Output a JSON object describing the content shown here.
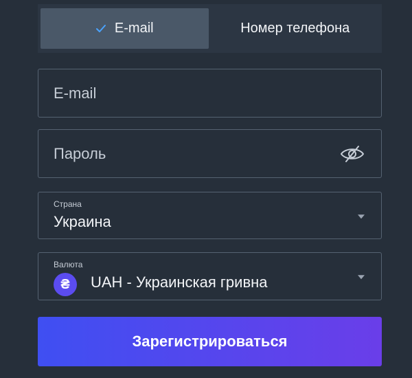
{
  "tabs": {
    "email_label": "E-mail",
    "phone_label": "Номер телефона",
    "active": "email"
  },
  "form": {
    "email_placeholder": "E-mail",
    "password_placeholder": "Пароль",
    "country_label": "Страна",
    "country_value": "Украина",
    "currency_label": "Валюта",
    "currency_symbol": "₴",
    "currency_value": "UAH - Украинская гривна",
    "submit_label": "Зарегистрироваться"
  },
  "colors": {
    "background": "#262f3a",
    "accent_start": "#3f4ff2",
    "accent_end": "#6a3ee9",
    "check": "#4aa3ff"
  },
  "icons": {
    "check": "check-icon",
    "eye": "eye-off-icon",
    "caret": "chevron-down-icon",
    "currency": "hryvnia-icon"
  }
}
